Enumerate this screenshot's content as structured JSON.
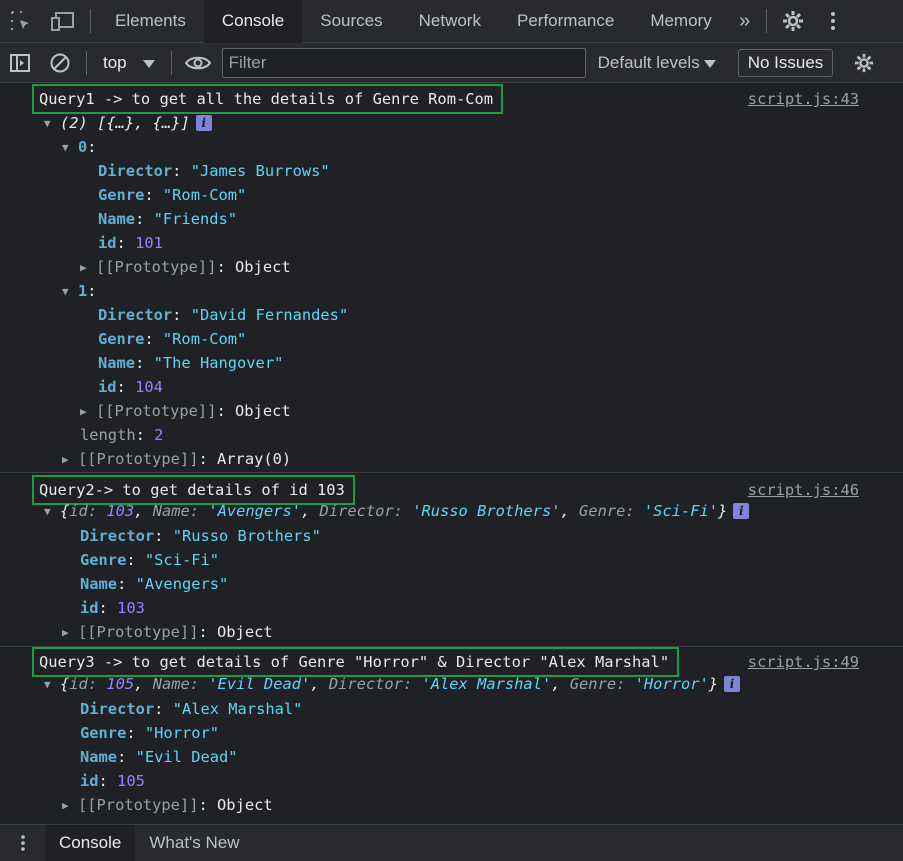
{
  "tabs": [
    "Elements",
    "Console",
    "Sources",
    "Network",
    "Performance",
    "Memory"
  ],
  "toolbar": {
    "context": "top",
    "filter_placeholder": "Filter",
    "levels_label": "Default levels",
    "issues_label": "No Issues"
  },
  "messages": {
    "m1": {
      "title": "Query1 -> to get all the details of Genre Rom-Com",
      "source": "script.js:43",
      "summary": "(2) [{…}, {…}]",
      "items": [
        {
          "index": "0",
          "director": "\"James Burrows\"",
          "genre": "\"Rom-Com\"",
          "name": "\"Friends\"",
          "id": "101"
        },
        {
          "index": "1",
          "director": "\"David Fernandes\"",
          "genre": "\"Rom-Com\"",
          "name": "\"The Hangover\"",
          "id": "104"
        }
      ],
      "length": "2",
      "proto_object": "Object",
      "proto_array": "Array(0)"
    },
    "m2": {
      "title": "Query2-> to get details of id 103",
      "source": "script.js:46",
      "preview": {
        "id": "103",
        "name": "'Avengers'",
        "director": "'Russo Brothers'",
        "genre": "'Sci-Fi'"
      },
      "director": "\"Russo Brothers\"",
      "genre": "\"Sci-Fi\"",
      "name": "\"Avengers\"",
      "id": "103",
      "proto": "Object"
    },
    "m3": {
      "title": "Query3 -> to get details of Genre \"Horror\" & Director \"Alex Marshal\"",
      "source": "script.js:49",
      "preview": {
        "id": "105",
        "name": "'Evil Dead'",
        "director": "'Alex Marshal'",
        "genre": "'Horror'"
      },
      "director": "\"Alex Marshal\"",
      "genre": "\"Horror\"",
      "name": "\"Evil Dead\"",
      "id": "105",
      "proto": "Object"
    }
  },
  "keys": {
    "director": "Director",
    "genre": "Genre",
    "name": "Name",
    "id": "id",
    "length": "length",
    "prototype": "[[Prototype]]"
  },
  "drawer": {
    "tabs": [
      "Console",
      "What's New"
    ]
  },
  "colors": {
    "highlight_border": "#1e9c45",
    "string": "#5cd5fb",
    "number": "#9980ff",
    "key": "#5db0d7"
  }
}
